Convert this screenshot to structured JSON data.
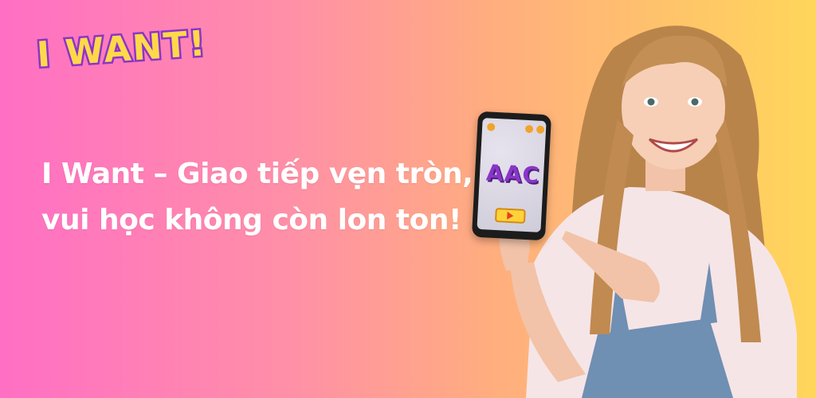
{
  "logo": {
    "text": "I WANT!"
  },
  "headline": {
    "line1": "I Want – Giao tiếp vẹn tròn,",
    "line2": "vui học không còn lon ton!"
  },
  "phone": {
    "screen_title": "AAC"
  },
  "colors": {
    "bg_left": "#ff6fc4",
    "bg_right": "#ffd65a",
    "logo_fill": "#ffd84a",
    "logo_outline": "#8a35c9"
  }
}
